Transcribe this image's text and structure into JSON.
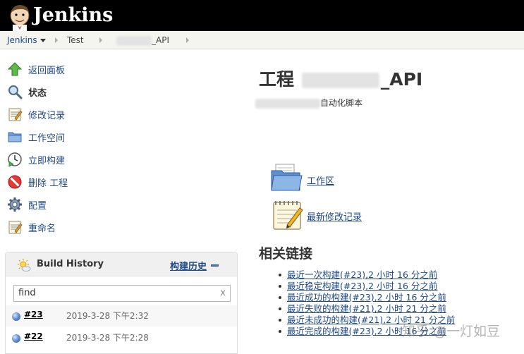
{
  "header": {
    "logo_text": "Jenkins"
  },
  "breadcrumb": {
    "root": "Jenkins",
    "folder": "Test",
    "job_suffix": "_API"
  },
  "sidebar": {
    "items": [
      {
        "label": "返回面板",
        "icon": "up-arrow-icon"
      },
      {
        "label": "状态",
        "icon": "search-icon"
      },
      {
        "label": "修改记录",
        "icon": "notepad-icon"
      },
      {
        "label": "工作空间",
        "icon": "folder-icon"
      },
      {
        "label": "立即构建",
        "icon": "clock-icon"
      },
      {
        "label": "删除 工程",
        "icon": "no-entry-icon"
      },
      {
        "label": "配置",
        "icon": "gear-icon"
      },
      {
        "label": "重命名",
        "icon": "notepad-icon"
      }
    ]
  },
  "build_history": {
    "title": "Build History",
    "link_label": "构建历史",
    "search_placeholder": "find",
    "clear_symbol": "x",
    "builds": [
      {
        "number": "#23",
        "date": "2019-3-28 下午2:32"
      },
      {
        "number": "#22",
        "date": "2019-3-28 下午2:28"
      }
    ]
  },
  "main": {
    "title_prefix": "工程",
    "title_suffix": "_API",
    "description": "自动化脚本",
    "workspace_link": "工作区",
    "changes_link": "最新修改记录",
    "related_title": "相关链接",
    "permalinks": [
      "最近一次构建(#23),2 小时 16 分之前",
      "最近稳定构建(#23),2 小时 16 分之前",
      "最近成功的构建(#23),2 小时 16 分之前",
      "最近失败的构建(#21),2 小时 21 分之前",
      "最近未成功的构建(#21),2 小时 21 分之前",
      "最近完成的构建(#23),2 小时 16 分之前"
    ]
  },
  "watermark": "知乎 @一灯如豆",
  "colors": {
    "header_bg": "#000000",
    "link": "#204a87",
    "breadcrumb_bg": "#f5f5ef"
  }
}
